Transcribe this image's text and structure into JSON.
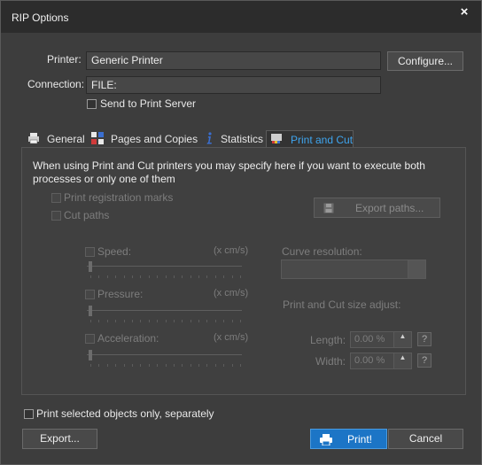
{
  "window": {
    "title": "RIP Options",
    "close_symbol": "×"
  },
  "printer": {
    "label": "Printer:",
    "value": "Generic Printer",
    "configure_label": "Configure..."
  },
  "connection": {
    "label": "Connection:",
    "value": "FILE:",
    "send_to_server_label": "Send to Print Server",
    "send_to_server_checked": false
  },
  "tabs": [
    {
      "label": "General",
      "icon": "printer-icon",
      "active": false
    },
    {
      "label": "Pages and Copies",
      "icon": "pages-grid-icon",
      "active": false
    },
    {
      "label": "Statistics",
      "icon": "info-icon",
      "active": false
    },
    {
      "label": "Print and Cut",
      "icon": "print-and-cut-icon",
      "active": true
    }
  ],
  "print_and_cut": {
    "description": "When using Print and Cut printers you may specify here if you want to execute both processes or only one of them",
    "print_registration_marks_label": "Print registration marks",
    "cut_paths_label": "Cut paths",
    "export_paths_label": "Export paths...",
    "speed_label": "Speed:",
    "speed_unit": "(x cm/s)",
    "pressure_label": "Pressure:",
    "pressure_unit": "(x cm/s)",
    "acceleration_label": "Acceleration:",
    "acceleration_unit": "(x cm/s)",
    "curve_resolution_label": "Curve resolution:",
    "size_adjust_label": "Print and Cut size adjust:",
    "length_label": "Length:",
    "length_value": "0.00 %",
    "width_label": "Width:",
    "width_value": "0.00 %",
    "help_symbol": "?"
  },
  "footer": {
    "print_selected_label": "Print selected objects only, separately",
    "export_label": "Export...",
    "print_label": "Print!",
    "cancel_label": "Cancel"
  },
  "colors": {
    "accent": "#3fa5ef",
    "print_button": "#1c75c6"
  }
}
